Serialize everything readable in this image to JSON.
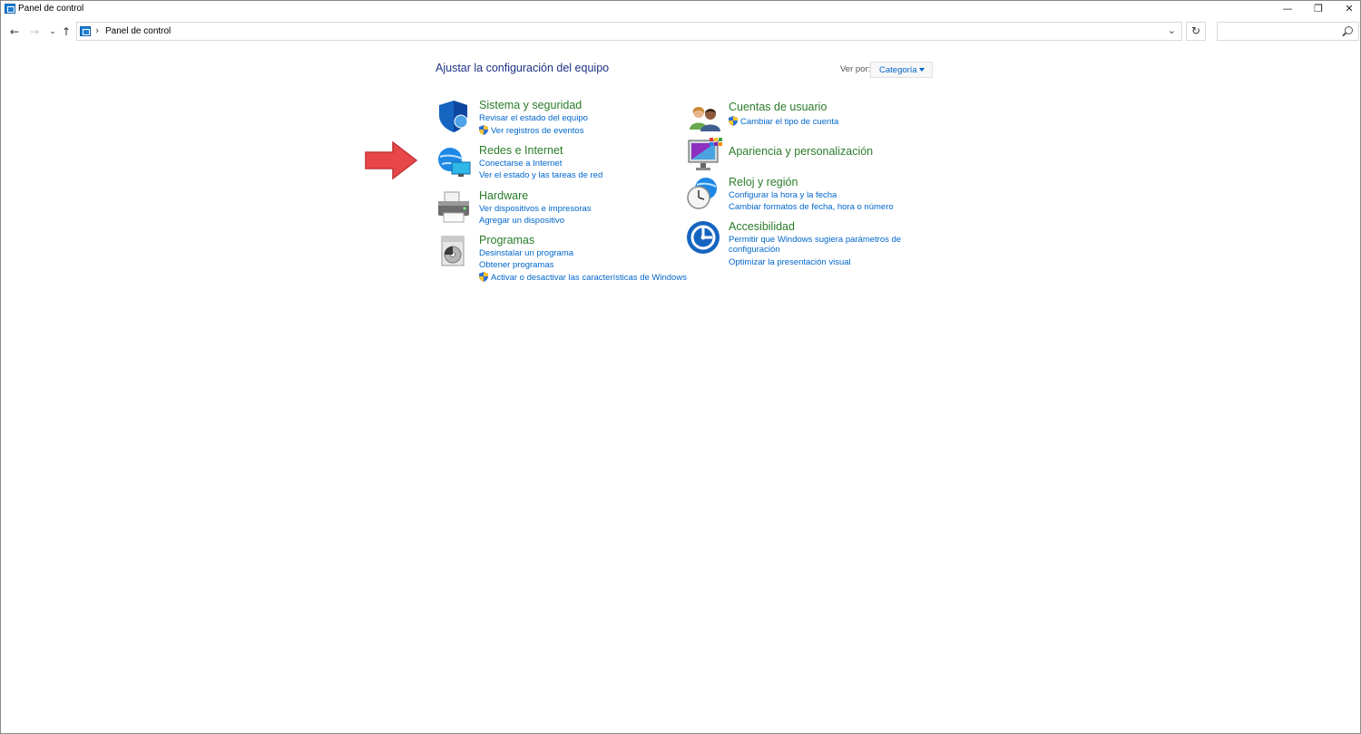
{
  "window": {
    "title": "Panel de control",
    "controls": {
      "minimize": "—",
      "restore": "❐",
      "close": "✕"
    }
  },
  "nav": {
    "back": "←",
    "forward": "→",
    "recent": "⌄",
    "up": "↑",
    "breadcrumb_separator": "›",
    "address": "Panel de control",
    "address_dropdown": "⌄",
    "refresh": "↻",
    "search_placeholder": ""
  },
  "content": {
    "heading": "Ajustar la configuración del equipo",
    "view_by_label": "Ver por:",
    "view_by_value": "Categoría"
  },
  "categories": [
    {
      "id": "sistema",
      "title": "Sistema y seguridad",
      "icon": "shield-icon",
      "links": [
        {
          "text": "Revisar el estado del equipo",
          "uac": false
        },
        {
          "text": "Ver registros de eventos",
          "uac": true
        }
      ]
    },
    {
      "id": "redes",
      "title": "Redes e Internet",
      "icon": "network-globe-icon",
      "links": [
        {
          "text": "Conectarse a Internet",
          "uac": false
        },
        {
          "text": "Ver el estado y las tareas de red",
          "uac": false
        }
      ]
    },
    {
      "id": "hardware",
      "title": "Hardware",
      "icon": "printer-icon",
      "links": [
        {
          "text": "Ver dispositivos e impresoras",
          "uac": false
        },
        {
          "text": "Agregar un dispositivo",
          "uac": false
        }
      ]
    },
    {
      "id": "programas",
      "title": "Programas",
      "icon": "programs-disc-icon",
      "links": [
        {
          "text": "Desinstalar un programa",
          "uac": false
        },
        {
          "text": "Obtener programas",
          "uac": false
        },
        {
          "text": "Activar o desactivar las características de Windows",
          "uac": true
        }
      ]
    },
    {
      "id": "cuentas",
      "title": "Cuentas de usuario",
      "icon": "users-icon",
      "links": [
        {
          "text": "Cambiar el tipo de cuenta",
          "uac": true
        }
      ]
    },
    {
      "id": "apariencia",
      "title": "Apariencia y personalización",
      "icon": "monitor-palette-icon",
      "links": []
    },
    {
      "id": "reloj",
      "title": "Reloj y región",
      "icon": "clock-globe-icon",
      "links": [
        {
          "text": "Configurar la hora y la fecha",
          "uac": false
        },
        {
          "text": "Cambiar formatos de fecha, hora o número",
          "uac": false
        }
      ]
    },
    {
      "id": "accesibilidad",
      "title": "Accesibilidad",
      "icon": "accessibility-icon",
      "links": [
        {
          "text": "Permitir que Windows sugiera parámetros de",
          "uac": false
        },
        {
          "text": "configuración",
          "uac": false
        },
        {
          "text": "Optimizar la presentación visual",
          "uac": false
        }
      ]
    }
  ],
  "annotation": {
    "icon": "red-arrow-icon",
    "color": "#e8474a"
  },
  "colors": {
    "link": "#0066cc",
    "category_title": "#2a7c2a",
    "heading": "#1e3287"
  }
}
